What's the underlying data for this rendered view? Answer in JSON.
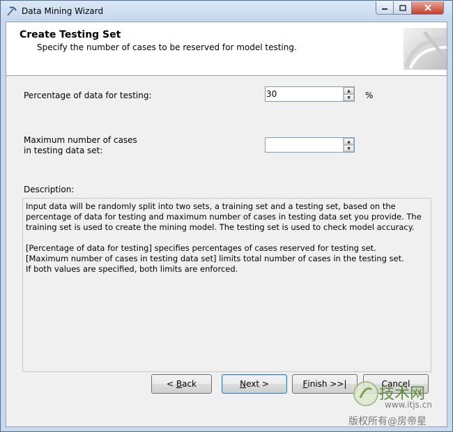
{
  "window": {
    "title": "Data Mining Wizard"
  },
  "header": {
    "title": "Create Testing Set",
    "subtitle": "Specify the number of cases to be reserved for model testing."
  },
  "fields": {
    "percentage_label": "Percentage of data for testing:",
    "percentage_value": "30",
    "percentage_unit": "%",
    "max_cases_label_line1": "Maximum number of cases",
    "max_cases_label_line2": "in testing data set:",
    "max_cases_value": ""
  },
  "description": {
    "label": "Description:",
    "para1": "Input data will be randomly split into two sets, a training set and a testing set, based on the percentage of data for testing and maximum number of cases in testing data set you provide. The training set is used to create the mining model. The testing set is used to check model accuracy.",
    "line2": "[Percentage of data for testing] specifies percentages of cases reserved for testing set.",
    "line3": "[Maximum number of cases in testing data set] limits total number of cases in the testing set.",
    "line4": "If both values are specified, both limits are enforced."
  },
  "buttons": {
    "back_prefix": "< ",
    "back_key": "B",
    "back_rest": "ack",
    "next_key": "N",
    "next_rest": "ext >",
    "finish_key": "F",
    "finish_rest": "inish >>|",
    "cancel": "Cancel"
  },
  "watermark": {
    "brand": "技术网",
    "url": "www.itjs.cn",
    "copyright": "版权所有@房帝星"
  },
  "colors": {
    "title_bar": "#c5d7ec",
    "close_button": "#c63f2a",
    "focus_border": "#3c7fb1"
  },
  "icons": {
    "app": "pickaxe-icon",
    "header_art": "pickaxe-art-icon"
  }
}
